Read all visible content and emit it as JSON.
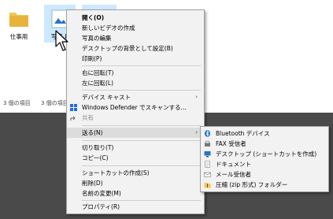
{
  "files": [
    {
      "label": "仕事用"
    },
    {
      "label": "写真.b"
    }
  ],
  "status": {
    "left": "3 個の項目",
    "right": "3 個の項目"
  },
  "context_menu": {
    "open": "開く(O)",
    "new_video": "新しいビデオの作成",
    "edit_photo": "写真の編集",
    "set_desktop": "デスクトップの背景として設定(B)",
    "print": "印刷(P)",
    "rotate_right": "右に回転(T)",
    "rotate_left": "左に回転(L)",
    "cast": "デバイス キャスト",
    "defender": "Windows Defender でスキャンする...",
    "share": "共有",
    "send_to": "送る(N)",
    "cut": "切り取り(T)",
    "copy": "コピー(C)",
    "create_shortcut": "ショートカットの作成(S)",
    "delete": "削除(D)",
    "rename": "名前の変更(M)",
    "properties": "プロパティ(R)"
  },
  "send_to_menu": [
    {
      "label": "Bluetooth デバイス",
      "icon": "bluetooth-icon"
    },
    {
      "label": "FAX 受信者",
      "icon": "fax-icon"
    },
    {
      "label": "デスクトップ (ショートカットを作成)",
      "icon": "desktop-icon"
    },
    {
      "label": "ドキュメント",
      "icon": "documents-icon"
    },
    {
      "label": "メール受信者",
      "icon": "mail-icon"
    },
    {
      "label": "圧縮 (zip 形式) フォルダー",
      "icon": "zip-folder-icon"
    }
  ],
  "colors": {
    "menu_bg": "#f2f2f2",
    "highlight": "#dcdcdc",
    "desktop": "#4a4a4a"
  }
}
